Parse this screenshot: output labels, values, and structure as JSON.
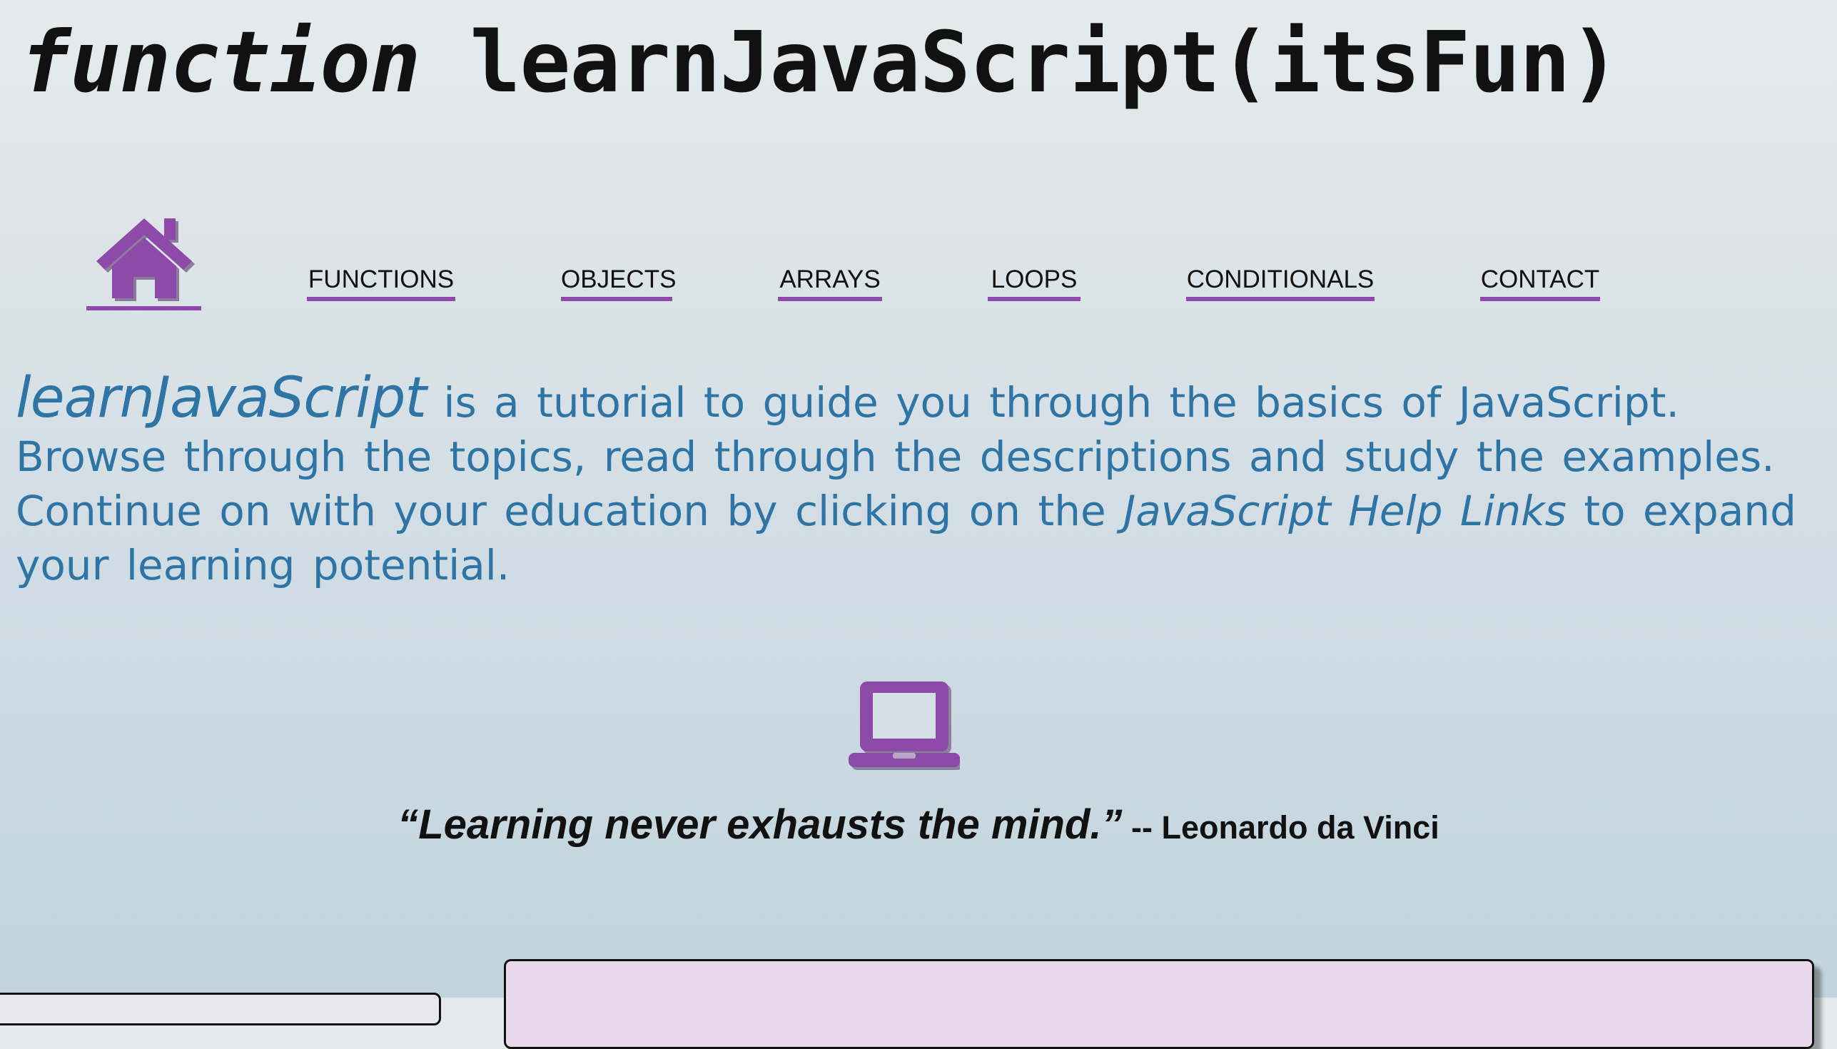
{
  "header": {
    "title_keyword": "function",
    "title_rest": " learnJavaScript(itsFun)"
  },
  "nav": {
    "home_icon": "home-icon",
    "items": [
      {
        "label": "FUNCTIONS"
      },
      {
        "label": "OBJECTS"
      },
      {
        "label": "ARRAYS"
      },
      {
        "label": "LOOPS"
      },
      {
        "label": "CONDITIONALS"
      },
      {
        "label": "CONTACT"
      }
    ],
    "underline_color": "#8e4aa8"
  },
  "intro": {
    "brand": "learnJavaScript",
    "text_1": " is a tutorial to guide you through the basics of JavaScript. Browse through the topics, read through the descriptions and study the examples. Continue on with your education by clicking on the ",
    "help_links": "JavaScript Help Links",
    "text_2": " to expand your learning potential.",
    "color": "#2e74a4"
  },
  "quote": {
    "icon": "laptop-icon",
    "text": "“Learning never exhausts the mind.”",
    "author": " -- Leonardo da Vinci"
  },
  "colors": {
    "accent": "#8e4aa8",
    "panel": "#e8d9ec"
  }
}
